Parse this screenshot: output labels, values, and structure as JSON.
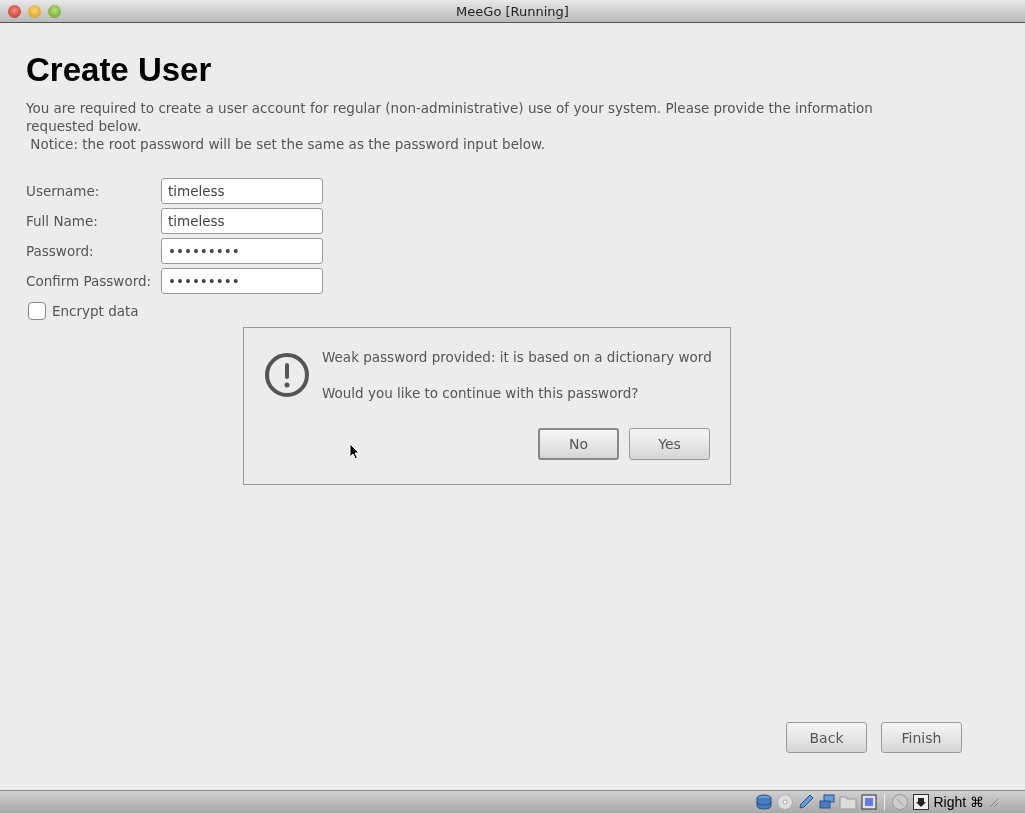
{
  "window": {
    "title": "MeeGo [Running]"
  },
  "page": {
    "title": "Create User",
    "description": "You are required to create a user account for regular (non-administrative) use of your system. Please provide the information requested below.",
    "notice": " Notice: the root password will be set the same as the password input below."
  },
  "fields": [
    {
      "label": "Username:",
      "value": "timeless"
    },
    {
      "label": "Full Name:",
      "value": "timeless"
    },
    {
      "label": "Password:",
      "value": "•••••••••"
    },
    {
      "label": "Confirm Password:",
      "value": "•••••••••"
    }
  ],
  "encrypt": {
    "label": "Encrypt data",
    "checked": false
  },
  "dialog": {
    "message": "Weak password provided: it is based on a dictionary word",
    "question": "Would you like to continue with this password?",
    "buttons": [
      {
        "label": "No",
        "default": true
      },
      {
        "label": "Yes",
        "default": false
      }
    ]
  },
  "nav_buttons": [
    "Back",
    "Finish"
  ],
  "status_bar": {
    "host_key": "Right ⌘"
  }
}
